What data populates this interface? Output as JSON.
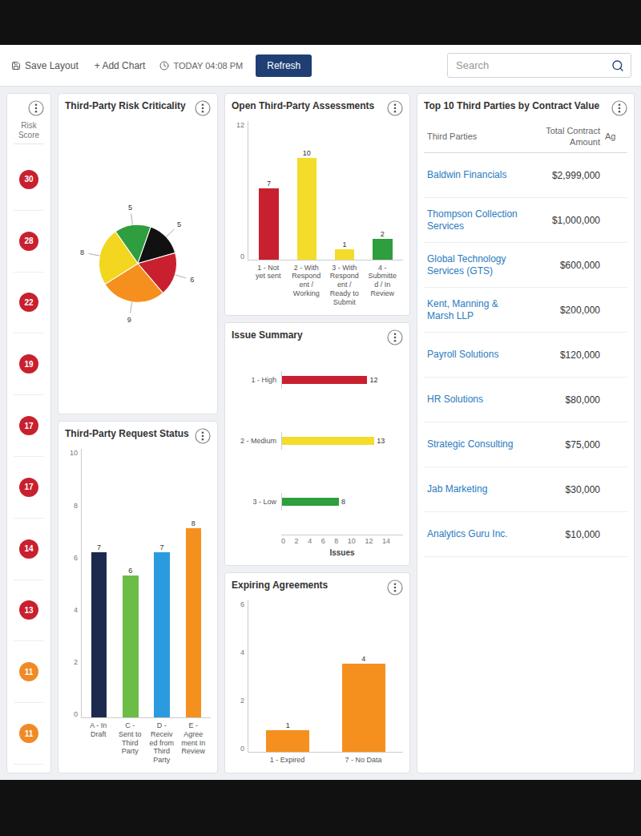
{
  "toolbar": {
    "actions": [
      {
        "label": "Save Layout",
        "kind": "icon"
      },
      {
        "label": "+ Add Chart",
        "kind": "text"
      }
    ],
    "timestamp": "TODAY 04:08 PM",
    "refresh": "Refresh"
  },
  "search": {
    "placeholder": "Search"
  },
  "risk_panel": {
    "column": "Risk Score",
    "scores": [
      {
        "value": "30",
        "color": "#c8202f"
      },
      {
        "value": "28",
        "color": "#c8202f"
      },
      {
        "value": "22",
        "color": "#c8202f"
      },
      {
        "value": "19",
        "color": "#c8202f"
      },
      {
        "value": "17",
        "color": "#c8202f"
      },
      {
        "value": "17",
        "color": "#c8202f"
      },
      {
        "value": "14",
        "color": "#c8202f"
      },
      {
        "value": "13",
        "color": "#c8202f"
      },
      {
        "value": "11",
        "color": "#f08a24"
      },
      {
        "value": "11",
        "color": "#f08a24"
      }
    ]
  },
  "risk_criticality": {
    "title": "Third-Party Risk Criticality",
    "slices": [
      {
        "label": "5",
        "value": 5,
        "color": "#2e9e3e"
      },
      {
        "label": "5",
        "value": 5,
        "color": "#111111"
      },
      {
        "label": "6",
        "value": 6,
        "color": "#c8202f"
      },
      {
        "label": "9",
        "value": 9,
        "color": "#f5901e"
      },
      {
        "label": "8",
        "value": 8,
        "color": "#f2d61f"
      }
    ]
  },
  "request_status": {
    "title": "Third-Party Request Status",
    "ticks": [
      "0",
      "2",
      "4",
      "6",
      "8",
      "10"
    ],
    "bars": [
      {
        "category": "A - In Draft",
        "value": 7,
        "label": "7",
        "color": "#1b2a4e"
      },
      {
        "category": "C - Sent to Third Party",
        "value": 6,
        "label": "6",
        "color": "#6cbd45"
      },
      {
        "category": "D - Received from Third Party",
        "value": 7,
        "label": "7",
        "color": "#2b9be0"
      },
      {
        "category": "E - Agreement In Review",
        "value": 8,
        "label": "8",
        "color": "#f5901e"
      }
    ]
  },
  "open_assessments": {
    "title": "Open Third-Party Assessments",
    "ticks": [
      "0",
      "12"
    ],
    "bars": [
      {
        "category": "1 - Not yet sent",
        "value": 7,
        "label": "7",
        "color": "#c8202f"
      },
      {
        "category": "2 - With Respondent / Working",
        "value": 10,
        "label": "10",
        "color": "#f3dc2a"
      },
      {
        "category": "3 - With Respondent / Ready to Submit",
        "value": 1,
        "label": "1",
        "color": "#f3dc2a"
      },
      {
        "category": "4 - Submitted / In Review",
        "value": 2,
        "label": "2",
        "color": "#2e9e3e"
      }
    ]
  },
  "issue_summary": {
    "title": "Issue Summary",
    "axis_title": "Issues",
    "ticks": [
      "0",
      "2",
      "4",
      "6",
      "8",
      "10",
      "12",
      "14"
    ],
    "bars": [
      {
        "category": "1 - High",
        "value": 12,
        "label": "12",
        "color": "#c8202f"
      },
      {
        "category": "2 - Medium",
        "value": 13,
        "label": "13",
        "color": "#f3dc2a"
      },
      {
        "category": "3 - Low",
        "value": 8,
        "label": "8",
        "color": "#2e9e3e"
      }
    ]
  },
  "expiring_agreements": {
    "title": "Expiring Agreements",
    "ticks": [
      "0",
      "2",
      "4",
      "6"
    ],
    "bars": [
      {
        "category": "1 - Expired",
        "value": 1,
        "label": "1",
        "color": "#f5901e"
      },
      {
        "category": "7 - No Data",
        "value": 4,
        "label": "4",
        "color": "#f5901e"
      }
    ]
  },
  "top_parties": {
    "title": "Top 10 Third Parties by Contract Value",
    "columns": [
      "Third Parties",
      "Total Contract Amount",
      "Ag"
    ],
    "rows": [
      {
        "name": "Baldwin Financials",
        "amount": "$2,999,000"
      },
      {
        "name": "Thompson Collection Services",
        "amount": "$1,000,000"
      },
      {
        "name": "Global Technology Services (GTS)",
        "amount": "$600,000"
      },
      {
        "name": "Kent, Manning & Marsh LLP",
        "amount": "$200,000"
      },
      {
        "name": "Payroll Solutions",
        "amount": "$120,000"
      },
      {
        "name": "HR Solutions",
        "amount": "$80,000"
      },
      {
        "name": "Strategic Consulting",
        "amount": "$75,000"
      },
      {
        "name": "Jab Marketing",
        "amount": "$30,000"
      },
      {
        "name": "Analytics Guru Inc.",
        "amount": "$10,000"
      }
    ]
  }
}
